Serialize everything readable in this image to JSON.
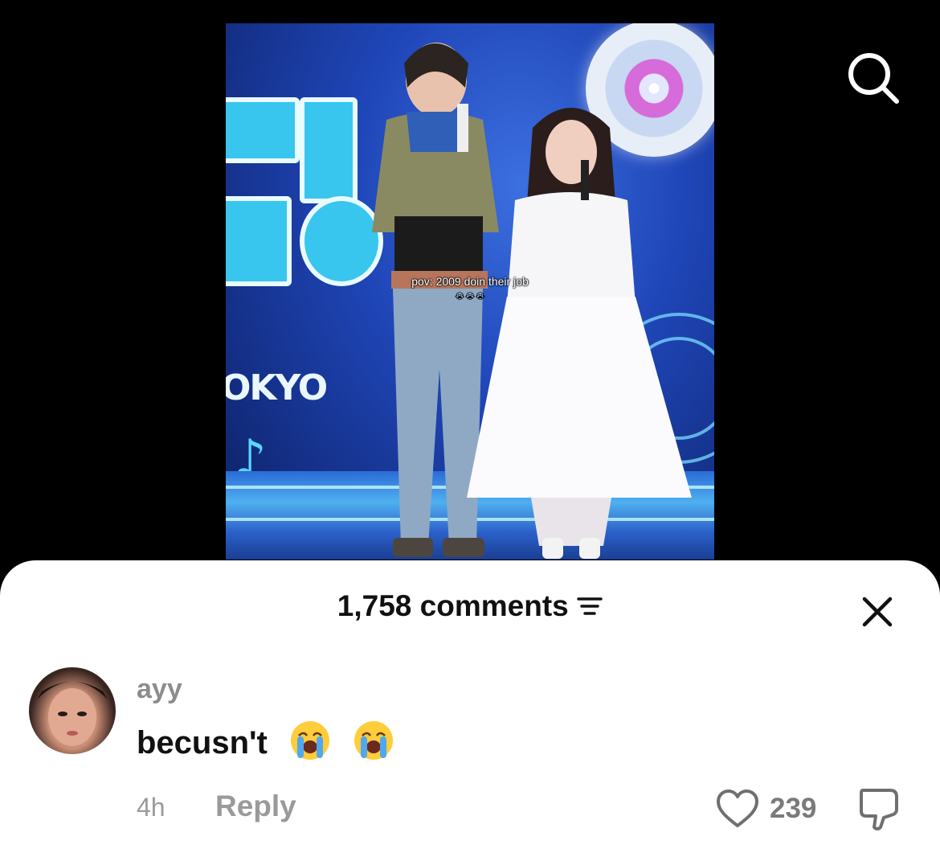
{
  "video": {
    "caption_line1": "pov: 2009 doin their job",
    "caption_emoji": "😭😭😭",
    "stage_text": "OKYO",
    "colors": {
      "stage_blue": "#1f46b8",
      "accent_cyan": "#38c6ef"
    }
  },
  "top_bar": {
    "search_icon": "search-icon"
  },
  "comments_sheet": {
    "count_label": "1,758 comments",
    "sort_icon": "sort-filter-icon",
    "close_icon": "close-icon"
  },
  "comment": {
    "username": "ayy",
    "text": "becusn't",
    "emoji": "😭 😭",
    "timestamp": "4h",
    "reply_label": "Reply",
    "like_count": "239",
    "like_icon": "heart-outline-icon",
    "dislike_icon": "thumbs-down-icon"
  }
}
